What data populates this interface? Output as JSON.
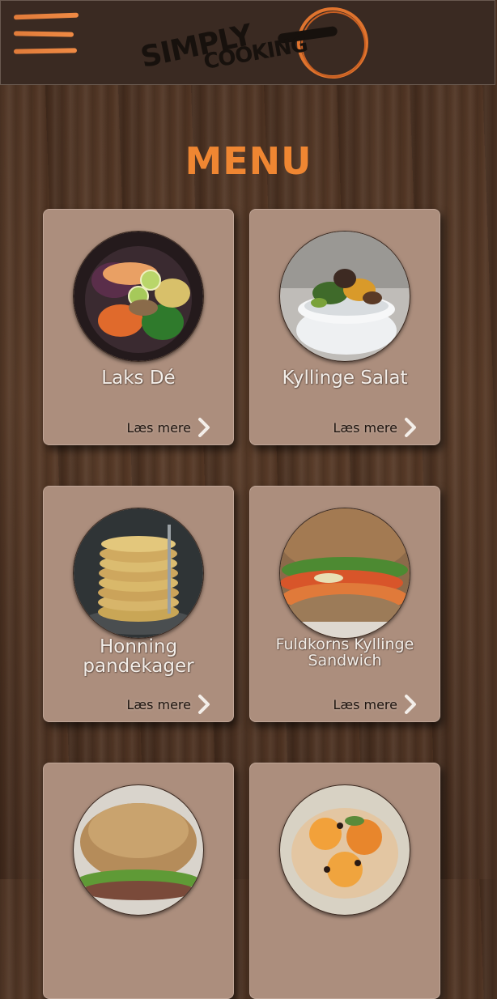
{
  "header": {
    "logo_text_top": "SIMPLY",
    "logo_text_bottom": "COOKING",
    "menu_icon": "hamburger-icon"
  },
  "page": {
    "title": "MENU"
  },
  "colors": {
    "accent": "#ef8632",
    "card": "#ac8e7d",
    "header": "#3a2a22"
  },
  "cards": [
    {
      "name": "Laks Dé",
      "more": "Læs mere"
    },
    {
      "name": "Kyllinge Salat",
      "more": "Læs mere"
    },
    {
      "name": "Honning pandekager",
      "more": "Læs mere"
    },
    {
      "name": "Fuldkorns Kyllinge Sandwich",
      "more": "Læs mere"
    },
    {
      "name": "",
      "more": ""
    },
    {
      "name": "",
      "more": ""
    }
  ]
}
